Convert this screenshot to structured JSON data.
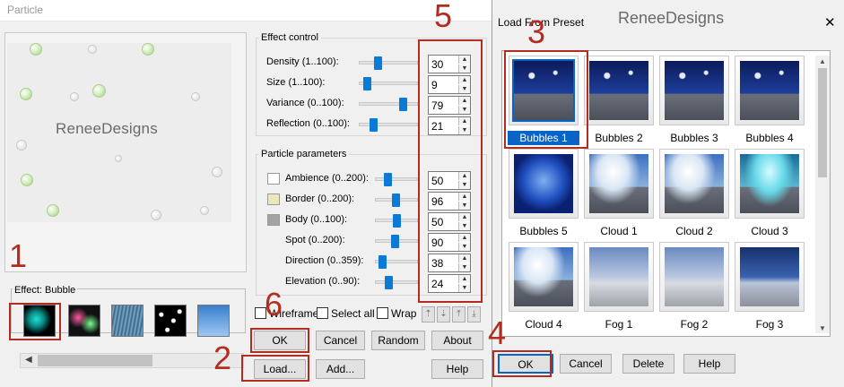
{
  "particle_dialog": {
    "title": "Particle",
    "watermark": "ReneeDesigns",
    "effect_label": "Effect: Bubble",
    "effects": [
      "bubble",
      "glitter",
      "rain",
      "stars",
      "clouds"
    ],
    "effect_control": {
      "title": "Effect control",
      "rows": [
        {
          "label": "Density (1..100):",
          "value": "30",
          "fraction": 0.3
        },
        {
          "label": "Size (1..100):",
          "value": "9",
          "fraction": 0.09
        },
        {
          "label": "Variance (0..100):",
          "value": "79",
          "fraction": 0.79
        },
        {
          "label": "Reflection (0..100):",
          "value": "21",
          "fraction": 0.21
        }
      ]
    },
    "particle_parameters": {
      "title": "Particle parameters",
      "rows": [
        {
          "label": "Ambience (0..200):",
          "value": "50",
          "fraction": 0.25,
          "swatch": "#ffffff"
        },
        {
          "label": "Border (0..200):",
          "value": "96",
          "fraction": 0.48,
          "swatch": "#ece7b8"
        },
        {
          "label": "Body (0..100):",
          "value": "50",
          "fraction": 0.5,
          "swatch": "#a3a3a3"
        },
        {
          "label": "Spot (0..200):",
          "value": "90",
          "fraction": 0.45
        },
        {
          "label": "Direction (0..359):",
          "value": "38",
          "fraction": 0.11
        },
        {
          "label": "Elevation (0..90):",
          "value": "24",
          "fraction": 0.27
        }
      ]
    },
    "checkboxes": {
      "wireframe": "Wireframe",
      "select_all": "Select all",
      "wrap": "Wrap"
    },
    "buttons": {
      "ok": "OK",
      "cancel": "Cancel",
      "random": "Random",
      "about": "About",
      "load": "Load...",
      "add": "Add...",
      "help": "Help"
    }
  },
  "preset_dialog": {
    "title": "Load From Preset",
    "watermark": "ReneeDesigns",
    "close": "✕",
    "presets": [
      {
        "label": "Bubbles 1",
        "selected": true,
        "style": "bubbles"
      },
      {
        "label": "Bubbles 2",
        "selected": false,
        "style": "bubbles"
      },
      {
        "label": "Bubbles 3",
        "selected": false,
        "style": "bubbles"
      },
      {
        "label": "Bubbles 4",
        "selected": false,
        "style": "bubbles"
      },
      {
        "label": "Bubbles 5",
        "selected": false,
        "style": "sphere"
      },
      {
        "label": "Cloud 1",
        "selected": false,
        "style": "cloud"
      },
      {
        "label": "Cloud 2",
        "selected": false,
        "style": "cloud"
      },
      {
        "label": "Cloud 3",
        "selected": false,
        "style": "cloud-teal"
      },
      {
        "label": "Cloud 4",
        "selected": false,
        "style": "cloud"
      },
      {
        "label": "Fog 1",
        "selected": false,
        "style": "fog"
      },
      {
        "label": "Fog 2",
        "selected": false,
        "style": "fog"
      },
      {
        "label": "Fog 3",
        "selected": false,
        "style": "fog-blue"
      }
    ],
    "buttons": {
      "ok": "OK",
      "cancel": "Cancel",
      "delete": "Delete",
      "help": "Help"
    }
  },
  "step_numbers": [
    "1",
    "2",
    "3",
    "4",
    "5",
    "6"
  ],
  "colors": {
    "annotation": "#b22d20",
    "accent": "#0a7ad6",
    "selection": "#0a64c8"
  }
}
